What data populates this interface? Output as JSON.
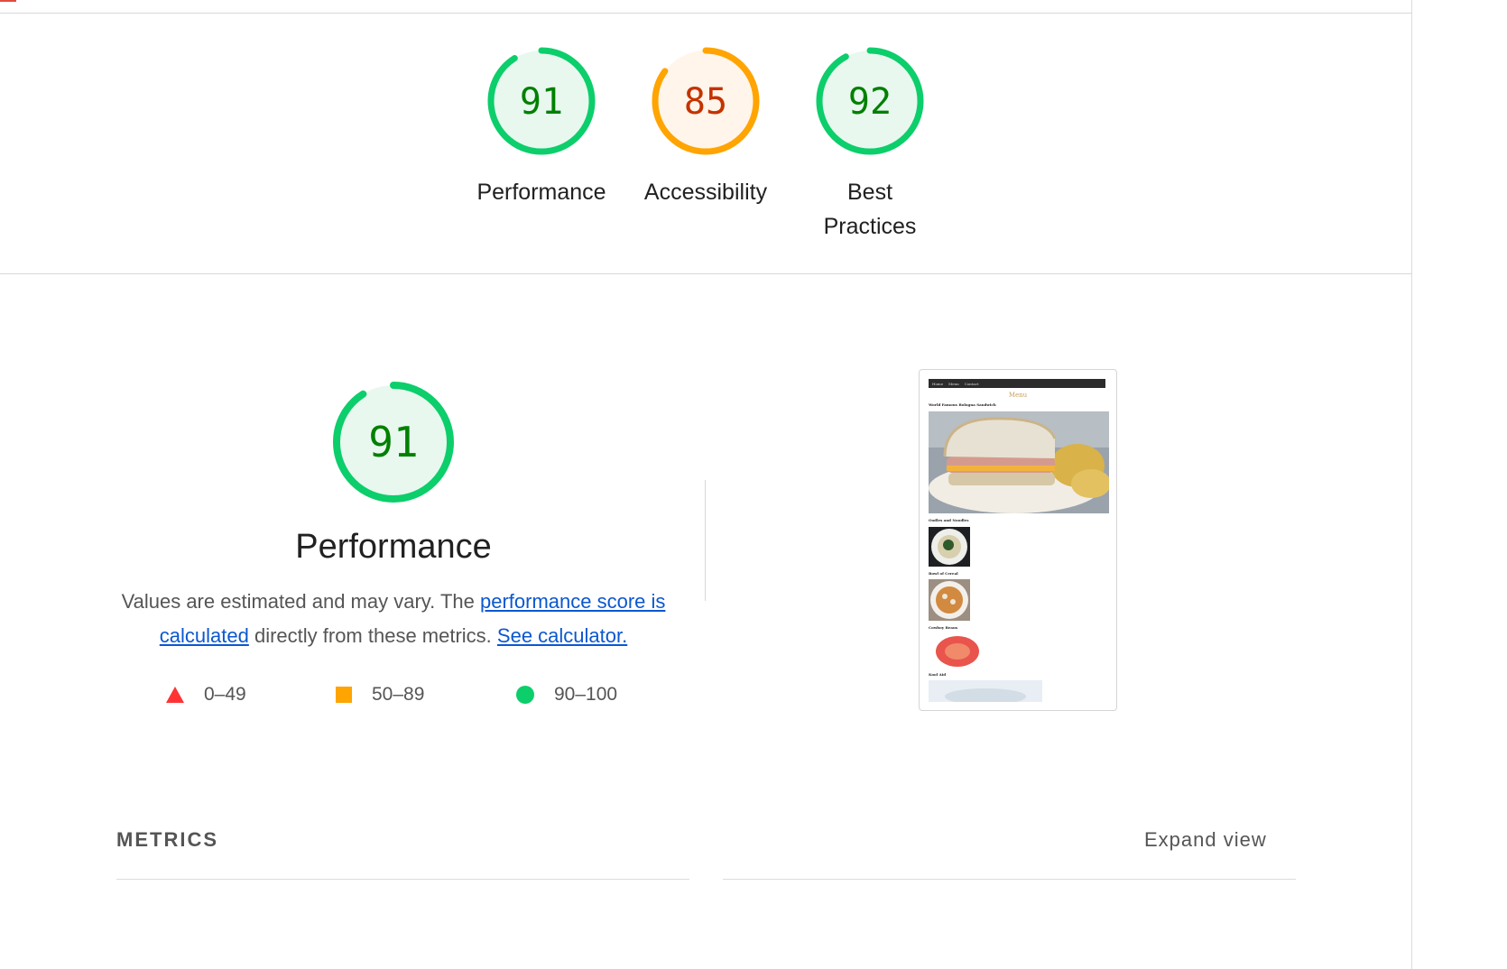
{
  "colors": {
    "pass": "#0cce6b",
    "average": "#ffa400",
    "fail": "#ff4e42",
    "pass_text": "#008000",
    "average_text": "#c33300"
  },
  "categories": [
    {
      "label": "Performance",
      "score": "91",
      "value": 0.91,
      "rating": "pass"
    },
    {
      "label": "Accessibility",
      "score": "85",
      "value": 0.85,
      "rating": "average"
    },
    {
      "label": "Best Practices",
      "score": "92",
      "value": 0.92,
      "rating": "pass"
    }
  ],
  "performance": {
    "score": "91",
    "value": 0.91,
    "title": "Performance",
    "desc_part1": "Values are estimated and may vary. The ",
    "link_score": "performance score is calculated",
    "desc_part2": " directly from these metrics. ",
    "link_calc": "See calculator."
  },
  "legend": [
    {
      "shape": "triangle",
      "range": "0–49"
    },
    {
      "shape": "square",
      "range": "50–89"
    },
    {
      "shape": "circle",
      "range": "90–100"
    }
  ],
  "screenshot": {
    "nav": [
      "Home",
      "Menu",
      "Contact"
    ],
    "heading": "Menu",
    "items": [
      "World Famous Bologna Sandwich",
      "Oodles and Noodles",
      "Bowl of Cereal",
      "Cowboy Beans",
      "Kool Aid"
    ]
  },
  "metrics": {
    "title": "METRICS",
    "expand_label": "Expand view"
  }
}
